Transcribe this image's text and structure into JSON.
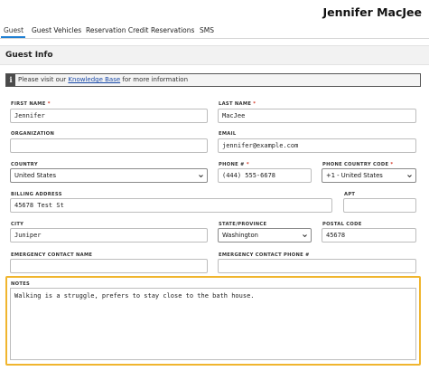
{
  "header": {
    "guest_name": "Jennifer MacJee"
  },
  "tabs": [
    {
      "label": "Guest"
    },
    {
      "label": "Guest Vehicles"
    },
    {
      "label": "Reservation Credit"
    },
    {
      "label": "Reservations"
    },
    {
      "label": "SMS"
    }
  ],
  "section": {
    "title": "Guest Info"
  },
  "banner": {
    "icon": "info-icon",
    "prefix": "Please visit our",
    "link": "Knowledge Base",
    "suffix": "for more information"
  },
  "form": {
    "required_mark": "*",
    "first_name": {
      "label": "FIRST NAME",
      "value": "Jennifer"
    },
    "last_name": {
      "label": "LAST NAME",
      "value": "MacJee"
    },
    "organization": {
      "label": "ORGANIZATION",
      "value": ""
    },
    "email": {
      "label": "EMAIL",
      "value": "jennifer@example.com"
    },
    "country": {
      "label": "COUNTRY",
      "value": "United States"
    },
    "phone": {
      "label": "PHONE #",
      "value": "(444) 555-6678"
    },
    "phone_country_code": {
      "label": "PHONE COUNTRY CODE",
      "value": "+1 - United States"
    },
    "billing_address": {
      "label": "BILLING ADDRESS",
      "value": "45678 Test St"
    },
    "apt": {
      "label": "APT",
      "value": ""
    },
    "city": {
      "label": "CITY",
      "value": "Juniper"
    },
    "state": {
      "label": "STATE/PROVINCE",
      "value": "Washington"
    },
    "postal_code": {
      "label": "POSTAL CODE",
      "value": "45678"
    },
    "emergency_name": {
      "label": "EMERGENCY CONTACT NAME",
      "value": ""
    },
    "emergency_phone": {
      "label": "EMERGENCY CONTACT PHONE #",
      "value": ""
    },
    "notes": {
      "label": "NOTES",
      "value": "Walking is a struggle, prefers to stay close to the bath house."
    }
  },
  "colors": {
    "accent": "#1e7fd3",
    "highlight": "#f0b52e",
    "required": "#d43a2a"
  }
}
